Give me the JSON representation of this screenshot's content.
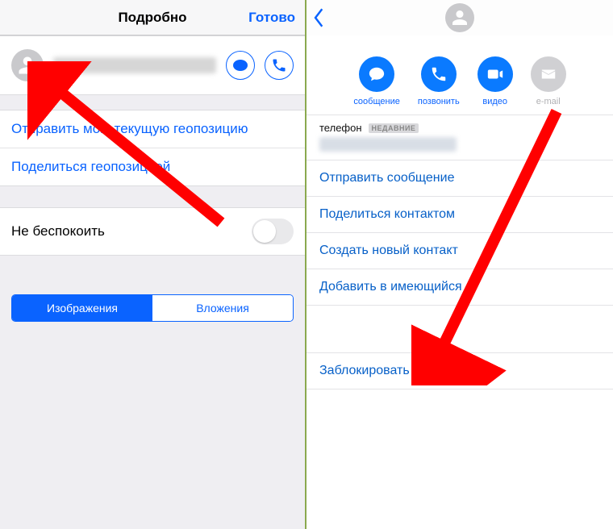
{
  "left": {
    "title": "Подробно",
    "done": "Готово",
    "send_location": "Отправить мою текущую геопозицию",
    "share_location": "Поделиться геопозицией",
    "do_not_disturb": "Не беспокоить",
    "seg_images": "Изображения",
    "seg_attachments": "Вложения"
  },
  "right": {
    "actions": {
      "message": "сообщение",
      "call": "позвонить",
      "video": "видео",
      "email": "e-mail"
    },
    "phone_label": "телефон",
    "badge": "НЕДАВНИЕ",
    "send_message": "Отправить сообщение",
    "share_contact": "Поделиться контактом",
    "create_contact": "Создать новый контакт",
    "add_existing": "Добавить в имеющийся",
    "block": "Заблокировать абонента"
  }
}
